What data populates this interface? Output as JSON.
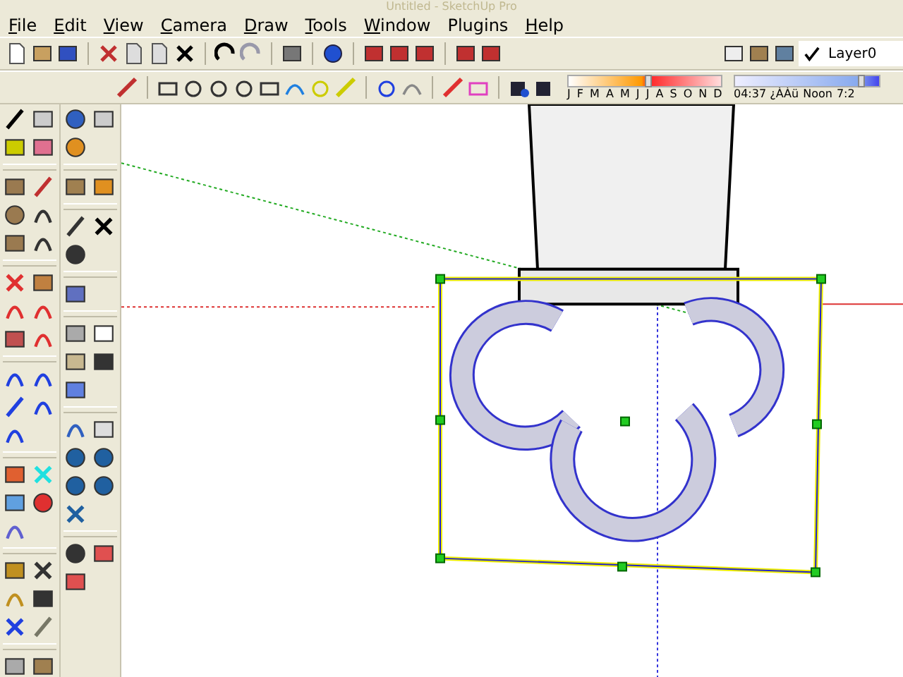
{
  "window": {
    "title": "Untitled - SketchUp Pro"
  },
  "menu": [
    {
      "label": "File"
    },
    {
      "label": "Edit"
    },
    {
      "label": "View"
    },
    {
      "label": "Camera"
    },
    {
      "label": "Draw"
    },
    {
      "label": "Tools"
    },
    {
      "label": "Window"
    },
    {
      "label": "Plugins"
    },
    {
      "label": "Help"
    }
  ],
  "shadow": {
    "months": [
      "J",
      "F",
      "M",
      "A",
      "M",
      "J",
      "J",
      "A",
      "S",
      "O",
      "N",
      "D"
    ],
    "month_slider": {
      "level": 0.5
    },
    "time_start": "04:37 ¿ÀÀü",
    "time_mid": "Noon",
    "time_end": "7:2",
    "time_slider": {
      "level": 0.85
    }
  },
  "layer": {
    "name": "Layer0",
    "checked": true
  }
}
